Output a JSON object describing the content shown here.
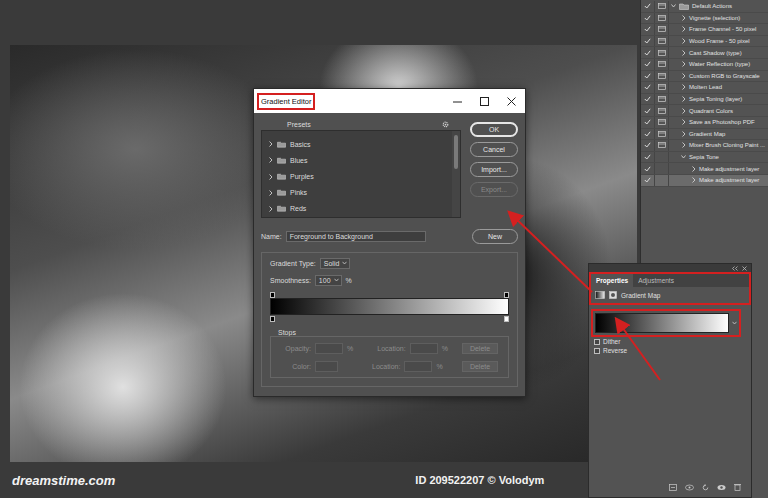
{
  "actions_panel": {
    "items": [
      {
        "label": "Default Actions",
        "kind": "set",
        "checked": true,
        "dialog": true,
        "expanded": true,
        "selected": false
      },
      {
        "label": "Vignette (selection)",
        "kind": "action",
        "checked": true,
        "dialog": true,
        "expanded": false,
        "selected": false
      },
      {
        "label": "Frame Channel - 50 pixel",
        "kind": "action",
        "checked": true,
        "dialog": true,
        "expanded": false,
        "selected": false
      },
      {
        "label": "Wood Frame - 50 pixel",
        "kind": "action",
        "checked": true,
        "dialog": true,
        "expanded": false,
        "selected": false
      },
      {
        "label": "Cast Shadow (type)",
        "kind": "action",
        "checked": true,
        "dialog": true,
        "expanded": false,
        "selected": false
      },
      {
        "label": "Water Reflection (type)",
        "kind": "action",
        "checked": true,
        "dialog": true,
        "expanded": false,
        "selected": false
      },
      {
        "label": "Custom RGB to Grayscale",
        "kind": "action",
        "checked": true,
        "dialog": true,
        "expanded": false,
        "selected": false
      },
      {
        "label": "Molten Lead",
        "kind": "action",
        "checked": true,
        "dialog": true,
        "expanded": false,
        "selected": false
      },
      {
        "label": "Sepia Toning (layer)",
        "kind": "action",
        "checked": true,
        "dialog": true,
        "expanded": false,
        "selected": false
      },
      {
        "label": "Quadrant Colors",
        "kind": "action",
        "checked": true,
        "dialog": true,
        "expanded": false,
        "selected": false
      },
      {
        "label": "Save as Photoshop PDF",
        "kind": "action",
        "checked": true,
        "dialog": true,
        "expanded": false,
        "selected": false
      },
      {
        "label": "Gradient Map",
        "kind": "action",
        "checked": true,
        "dialog": true,
        "expanded": false,
        "selected": false
      },
      {
        "label": "Mixer Brush Cloning Paint ...",
        "kind": "action",
        "checked": true,
        "dialog": true,
        "expanded": false,
        "selected": false
      },
      {
        "label": "Sepia Tone",
        "kind": "action",
        "checked": true,
        "dialog": false,
        "expanded": true,
        "selected": false
      },
      {
        "label": "Make adjustment layer",
        "kind": "step",
        "checked": true,
        "dialog": false,
        "expanded": false,
        "selected": false
      },
      {
        "label": "Make adjustment layer",
        "kind": "step",
        "checked": true,
        "dialog": false,
        "expanded": false,
        "selected": true
      }
    ]
  },
  "gradient_editor": {
    "title": "Gradient Editor",
    "title_highlighted": true,
    "presets": {
      "label": "Presets",
      "folders": [
        {
          "label": "Basics",
          "expanded": false
        },
        {
          "label": "Blues",
          "expanded": false
        },
        {
          "label": "Purples",
          "expanded": false
        },
        {
          "label": "Pinks",
          "expanded": false
        },
        {
          "label": "Reds",
          "expanded": false
        }
      ]
    },
    "buttons": [
      {
        "label": "OK",
        "default": true,
        "disabled": false
      },
      {
        "label": "Cancel",
        "default": false,
        "disabled": false
      },
      {
        "label": "Import...",
        "default": false,
        "disabled": false
      },
      {
        "label": "Export...",
        "default": false,
        "disabled": true
      }
    ],
    "name": {
      "label": "Name:",
      "value": "Foreground to Background"
    },
    "new_button": "New",
    "gradient_type": {
      "label": "Gradient Type:",
      "value": "Solid"
    },
    "smoothness": {
      "label": "Smoothness:",
      "value": "100",
      "unit": "%"
    },
    "opacity_stops": [
      {
        "color": "#000000"
      },
      {
        "color": "#000000"
      }
    ],
    "color_stops": [
      {
        "color": "#000000"
      },
      {
        "color": "#ffffff"
      }
    ],
    "stops": {
      "label": "Stops",
      "rows": [
        {
          "label": "Opacity:",
          "kind": "opacity",
          "unit": "%",
          "location_label": "Location:",
          "location_unit": "%",
          "delete": "Delete",
          "disabled": true
        },
        {
          "label": "Color:",
          "kind": "color",
          "unit": "",
          "location_label": "Location:",
          "location_unit": "%",
          "delete": "Delete",
          "disabled": true
        }
      ]
    }
  },
  "properties_panel": {
    "tabs": [
      {
        "label": "Properties",
        "selected": true
      },
      {
        "label": "Adjustments",
        "selected": false
      }
    ],
    "title": "Gradient Map",
    "highlighted": true,
    "gradient": {
      "highlighted": true,
      "color_stops": [
        {
          "color": "#000000"
        },
        {
          "color": "#ffffff"
        }
      ]
    },
    "options": [
      {
        "label": "Dither",
        "checked": false
      },
      {
        "label": "Reverse",
        "checked": false
      }
    ]
  },
  "footer": {
    "brand": "dreamstime.com",
    "credit": "ID 209522207 © Volodym"
  }
}
